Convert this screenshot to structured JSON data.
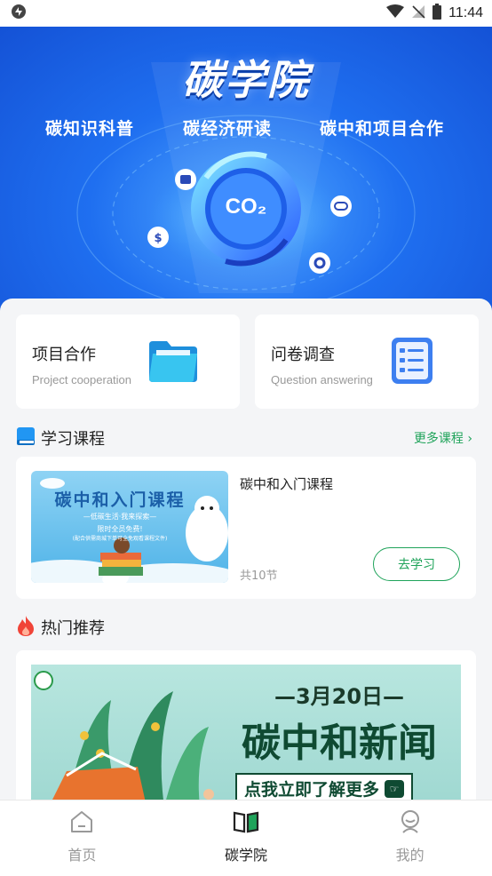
{
  "status_bar": {
    "time": "11:44",
    "icons": [
      "app-notification-icon",
      "wifi-icon",
      "no-signal-icon",
      "battery-icon"
    ]
  },
  "hero": {
    "title": "碳学院",
    "tags": [
      "碳知识科普",
      "碳经济研读",
      "碳中和项目合作"
    ],
    "center_text": "CO₂"
  },
  "quick_cards": [
    {
      "title": "项目合作",
      "subtitle": "Project cooperation",
      "icon": "folder-icon"
    },
    {
      "title": "问卷调查",
      "subtitle": "Question answering",
      "icon": "checklist-icon"
    }
  ],
  "courses": {
    "section_title": "学习课程",
    "more_label": "更多课程",
    "items": [
      {
        "name": "碳中和入门课程",
        "count": "共10节",
        "button_label": "去学习",
        "thumb": {
          "title": "碳中和入门课程",
          "subtitle": "—低碳生活·我来探索—",
          "line1": "限时全员免费!",
          "line2": "(配合供需商城下单可全免观看课程文件)"
        }
      }
    ]
  },
  "hot": {
    "section_title": "热门推荐",
    "banner": {
      "date": "—3月20日—",
      "headline": "碳中和新闻",
      "cta": "点我立即了解更多"
    }
  },
  "bottom_nav": [
    {
      "label": "首页",
      "icon": "home-icon",
      "active": false
    },
    {
      "label": "碳学院",
      "icon": "book-icon",
      "active": true
    },
    {
      "label": "我的",
      "icon": "profile-icon",
      "active": false
    }
  ],
  "colors": {
    "accent": "#1fa35a",
    "hero_blue": "#1f6ff0",
    "page_bg": "#f4f5f7"
  }
}
